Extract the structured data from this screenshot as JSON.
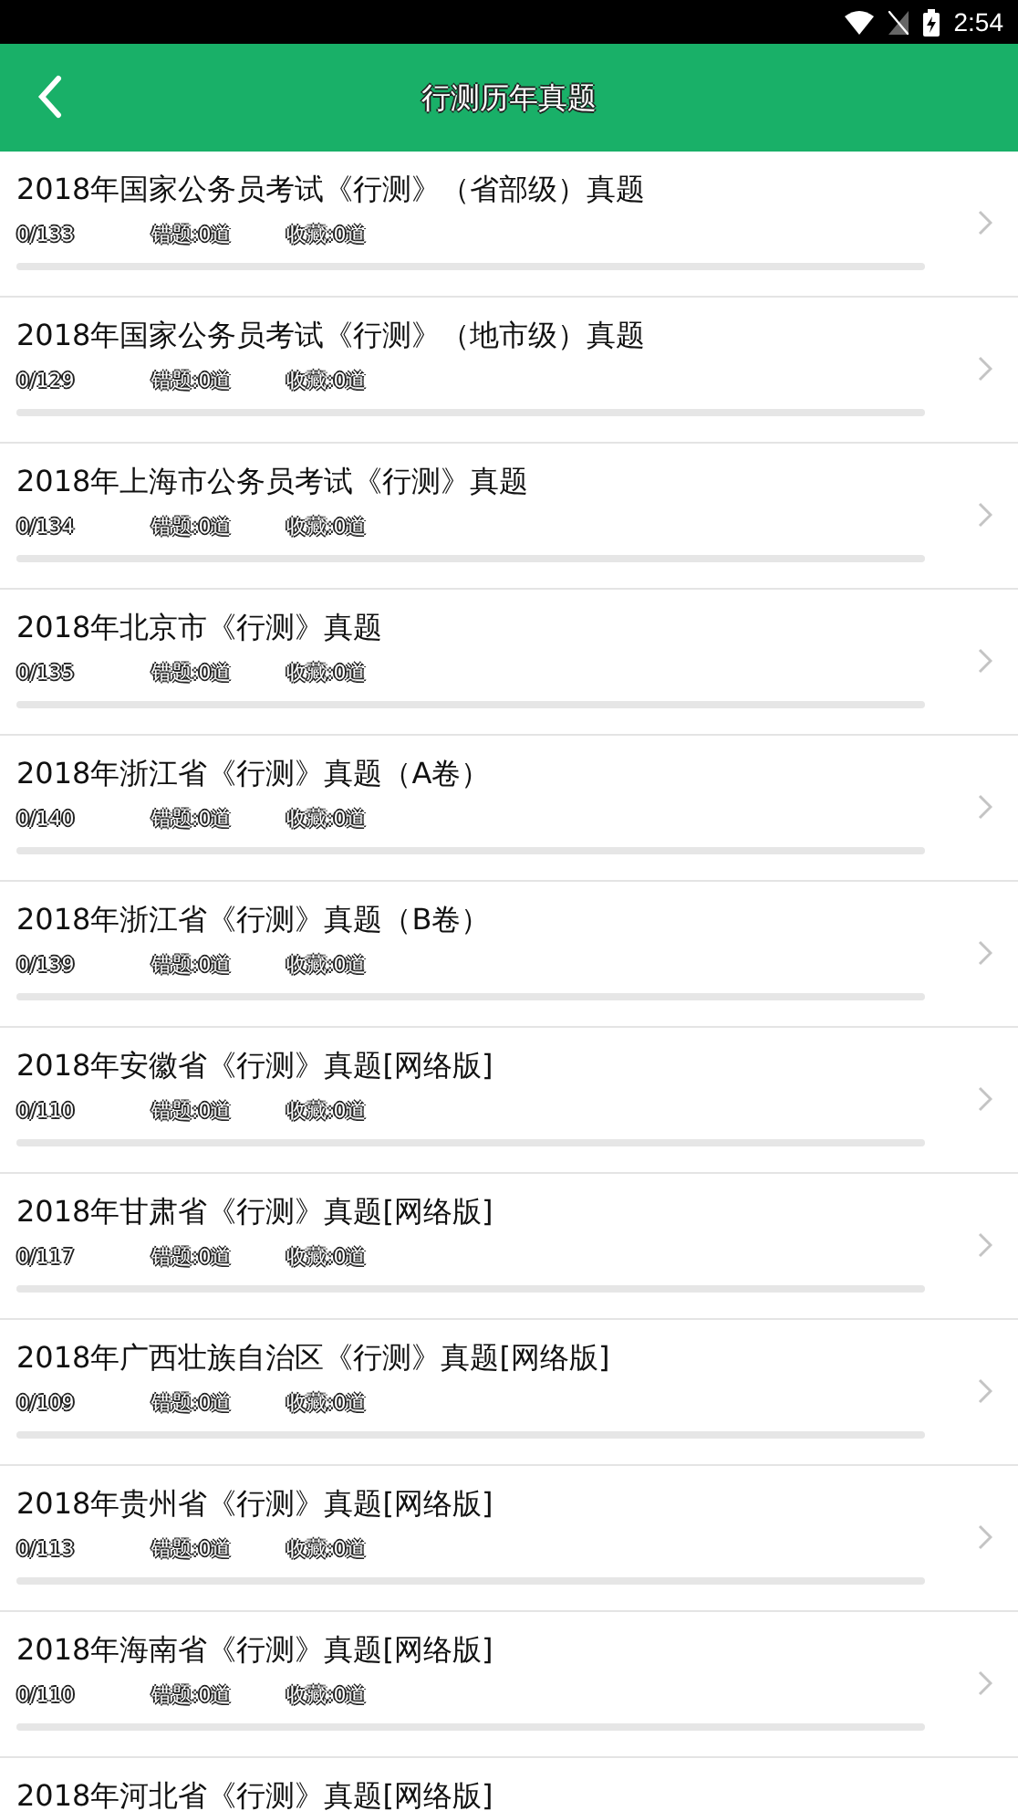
{
  "status_bar": {
    "time": "2:54"
  },
  "header": {
    "title": "行测历年真题"
  },
  "items": [
    {
      "title": "2018年国家公务员考试《行测》（省部级）真题",
      "progress": "0/133",
      "wrong": "错题:0道",
      "favorites": "收藏:0道",
      "level": 0
    },
    {
      "title": "2018年国家公务员考试《行测》（地市级）真题",
      "progress": "0/129",
      "wrong": "错题:0道",
      "favorites": "收藏:0道",
      "level": 0
    },
    {
      "title": "2018年上海市公务员考试《行测》真题",
      "progress": "0/134",
      "wrong": "错题:0道",
      "favorites": "收藏:0道",
      "level": 0
    },
    {
      "title": "2018年北京市《行测》真题",
      "progress": "0/135",
      "wrong": "错题:0道",
      "favorites": "收藏:0道",
      "level": 0
    },
    {
      "title": "2018年浙江省《行测》真题（A卷）",
      "progress": "0/140",
      "wrong": "错题:0道",
      "favorites": "收藏:0道",
      "level": 0
    },
    {
      "title": "2018年浙江省《行测》真题（B卷）",
      "progress": "0/139",
      "wrong": "错题:0道",
      "favorites": "收藏:0道",
      "level": 0
    },
    {
      "title": "2018年安徽省《行测》真题[网络版]",
      "progress": "0/110",
      "wrong": "错题:0道",
      "favorites": "收藏:0道",
      "level": 0
    },
    {
      "title": "2018年甘肃省《行测》真题[网络版]",
      "progress": "0/117",
      "wrong": "错题:0道",
      "favorites": "收藏:0道",
      "level": 0
    },
    {
      "title": "2018年广西壮族自治区《行测》真题[网络版]",
      "progress": "0/109",
      "wrong": "错题:0道",
      "favorites": "收藏:0道",
      "level": 0
    },
    {
      "title": "2018年贵州省《行测》真题[网络版]",
      "progress": "0/113",
      "wrong": "错题:0道",
      "favorites": "收藏:0道",
      "level": 0
    },
    {
      "title": "2018年海南省《行测》真题[网络版]",
      "progress": "0/110",
      "wrong": "错题:0道",
      "favorites": "收藏:0道",
      "level": 0
    },
    {
      "title": "2018年河北省《行测》真题[网络版]"
    }
  ]
}
